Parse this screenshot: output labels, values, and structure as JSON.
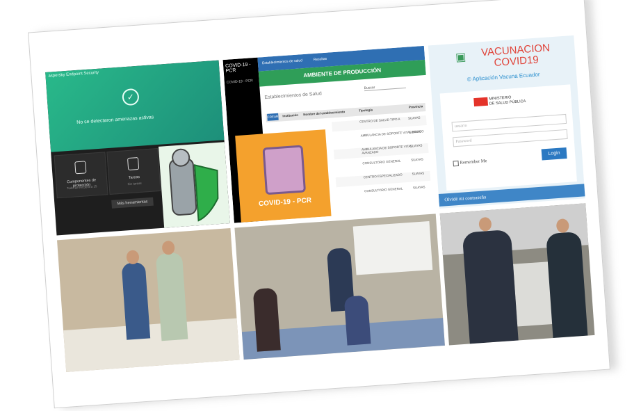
{
  "panels": {
    "antivirus": {
      "title": "aspersky Endpoint Security",
      "status_message": "No se detectaron amenazas activas",
      "tiles": [
        {
          "label": "Componentes de protección",
          "sub": "Todo se encuentra 15"
        },
        {
          "label": "Tareas",
          "sub": "Sin tareas"
        }
      ],
      "more_button": "Más herramientas"
    },
    "covid_pcr": {
      "sidebar_title": "COVID-19 - PCR",
      "sidebar_item": "COVID-19 - PCR",
      "tabs": [
        "Establecimientos de salud",
        "Resultas"
      ],
      "environment": "AMBIENTE DE PRODUCCIÓN",
      "list_title": "Establecimientos de Salud",
      "search_label": "Buscar",
      "new_button": "CREAR",
      "columns": [
        "Institución",
        "Nombre del establecimiento",
        "Tipología",
        "Provincia"
      ],
      "rows": [
        {
          "tipologia": "CENTRO DE SALUD TIPO A",
          "provincia": "SUAYAS"
        },
        {
          "tipologia": "AMBULANCIA DE SOPORTE VITAL BÁSICO",
          "provincia": "SUAYAS"
        },
        {
          "tipologia": "AMBULANCIA DE SOPORTE VITAL AVANZADO",
          "provincia": "SUAYAS"
        },
        {
          "tipologia": "CONSULTORIO GENERAL",
          "provincia": "SUAYAS"
        },
        {
          "tipologia": "CENTRO ESPECIALIZADO",
          "provincia": "SUAYAS"
        },
        {
          "tipologia": "CONSULTORIO GENERAL",
          "provincia": "SUAYAS"
        }
      ],
      "logo_text": "COVID-19 - PCR"
    },
    "vacunacion": {
      "title_line1": "VACUNACION",
      "title_line2": "COVID19",
      "subtitle": "© Aplicación Vacuna Ecuador",
      "ministry_line1": "MINISTERIO",
      "ministry_line2": "DE SALUD PÚBLICA",
      "username_placeholder": "usuario",
      "password_placeholder": "Password",
      "remember_label": "Remember Me",
      "login_button": "Login",
      "forgot_link": "Olvidé mi contraseña"
    }
  },
  "colors": {
    "antivirus_green": "#29b98a",
    "pcr_blue": "#2f6fb3",
    "pcr_green": "#2f9e58",
    "pcr_orange": "#f4a12d",
    "vac_red": "#e0443a",
    "vac_blue": "#2b79c2"
  }
}
